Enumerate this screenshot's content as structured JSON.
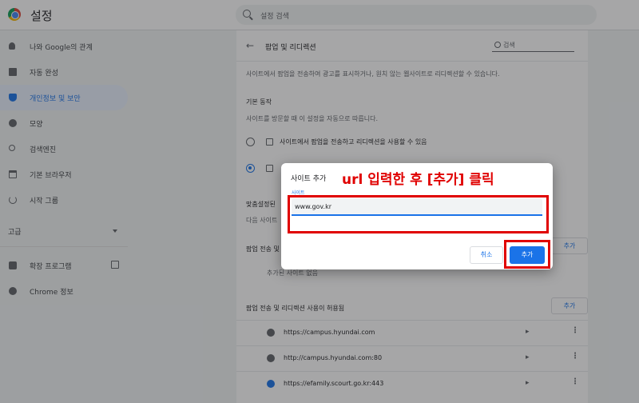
{
  "header": {
    "app_title": "설정",
    "search_placeholder": "설정 검색"
  },
  "sidebar": {
    "items": [
      {
        "label": "나와 Google의 관계",
        "icon": "person-icon",
        "active": false
      },
      {
        "label": "자동 완성",
        "icon": "clipboard-icon",
        "active": false
      },
      {
        "label": "개인정보 및 보안",
        "icon": "shield-icon",
        "active": true
      },
      {
        "label": "모양",
        "icon": "palette-icon",
        "active": false
      },
      {
        "label": "검색엔진",
        "icon": "search-icon",
        "active": false
      },
      {
        "label": "기본 브라우저",
        "icon": "browser-icon",
        "active": false
      },
      {
        "label": "시작 그룹",
        "icon": "power-icon",
        "active": false
      }
    ],
    "advanced_label": "고급",
    "extensions_label": "확장 프로그램",
    "about_label": "Chrome 정보"
  },
  "main": {
    "back_icon": "back-arrow-icon",
    "title": "팝업 및 리디렉션",
    "search_placeholder": "검색",
    "description": "사이트에서 팝업을 전송하여 광고를 표시하거나, 원치 않는 웹사이트로 리디렉션할 수 있습니다.",
    "default_behavior_title": "기본 동작",
    "default_behavior_sub": "사이트를 방문할 때 이 설정을 자동으로 따릅니다.",
    "option_allow": "사이트에서 팝업을 전송하고 리디렉션을 사용할 수 있음",
    "custom_title_partial": "맞춤설정된",
    "custom_sub_partial": "다음 사이트",
    "blocked_title_partial": "팝업 전송 및",
    "no_sites": "추가된 사이트 없음",
    "allowed_title": "팝업 전송 및 리디렉션 사용이 허용됨",
    "add_label": "추가",
    "allowed_sites": [
      "https://campus.hyundai.com",
      "http://campus.hyundai.com:80",
      "https://efamily.scourt.go.kr:443"
    ]
  },
  "dialog": {
    "title": "사이트 추가",
    "field_label": "사이트",
    "input_value": "www.gov.kr",
    "cancel_label": "취소",
    "add_label": "추가"
  },
  "annotation": {
    "text": "url 입력한 후 [추가] 클릭",
    "color": "#e00000"
  },
  "colors": {
    "accent": "#1a73e8",
    "active_nav_bg": "#e8f0fe"
  }
}
